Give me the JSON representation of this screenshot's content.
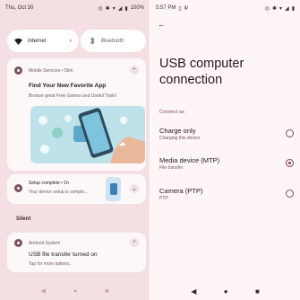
{
  "left": {
    "status_bar": {
      "time": "Thu, Oct 30",
      "battery": "100%"
    },
    "quick_settings": {
      "internet": {
        "label": "Internet",
        "icon": "wifi-icon"
      },
      "bluetooth": {
        "label": "Bluetooth",
        "icon": "bluetooth-icon"
      }
    },
    "notifications": [
      {
        "app": "Mobile Services • 56m",
        "title": "Find Your New Favorite App",
        "body": "Browse great Free Games and Useful Tools!"
      },
      {
        "app": "Setup complete • 1h",
        "body": "Your device setup is comple..."
      }
    ],
    "silent_label": "Silent",
    "silent_notification": {
      "app": "Android System",
      "title": "USB file transfer turned on",
      "body": "Tap for more options."
    },
    "nav": [
      "◀",
      "●",
      "■"
    ]
  },
  "right": {
    "status_bar": {
      "time": "5:57 PM"
    },
    "title": "USB computer connection",
    "section": "Connect as",
    "options": [
      {
        "title": "Charge only",
        "subtitle": "Charging this device",
        "selected": false
      },
      {
        "title": "Media device (MTP)",
        "subtitle": "File transfer",
        "selected": true
      },
      {
        "title": "Camera (PTP)",
        "subtitle": "PTP",
        "selected": false
      }
    ],
    "nav": [
      "◀",
      "●",
      "■"
    ]
  },
  "colors": {
    "accent": "#8c3a55",
    "shade_bg": "#f4dfe2",
    "card_bg": "#fdf8f8"
  }
}
